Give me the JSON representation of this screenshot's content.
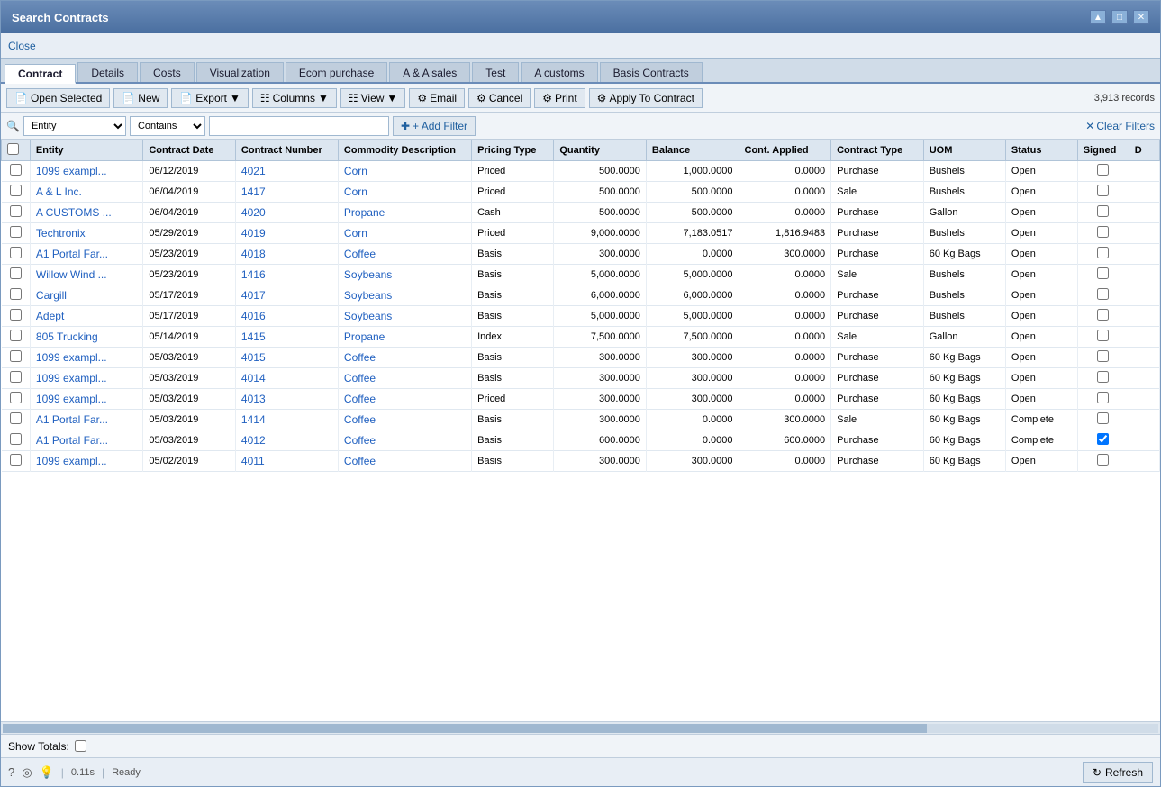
{
  "window": {
    "title": "Search Contracts"
  },
  "menu": {
    "close_label": "Close"
  },
  "tabs": [
    {
      "id": "contract",
      "label": "Contract",
      "active": true
    },
    {
      "id": "details",
      "label": "Details",
      "active": false
    },
    {
      "id": "costs",
      "label": "Costs",
      "active": false
    },
    {
      "id": "visualization",
      "label": "Visualization",
      "active": false
    },
    {
      "id": "ecom",
      "label": "Ecom purchase",
      "active": false
    },
    {
      "id": "aasales",
      "label": "A & A sales",
      "active": false
    },
    {
      "id": "test",
      "label": "Test",
      "active": false
    },
    {
      "id": "acustoms",
      "label": "A customs",
      "active": false
    },
    {
      "id": "basis",
      "label": "Basis Contracts",
      "active": false
    }
  ],
  "toolbar": {
    "open_selected": "Open Selected",
    "new": "New",
    "export": "Export",
    "columns": "Columns",
    "view": "View",
    "email": "Email",
    "cancel": "Cancel",
    "print": "Print",
    "apply_to_contract": "Apply To Contract",
    "record_count": "3,913 records"
  },
  "filter": {
    "field_label": "Entity",
    "operator_label": "Contains",
    "value": "",
    "add_filter_label": "+ Add Filter",
    "clear_filters_label": "Clear Filters"
  },
  "columns": [
    "Entity",
    "Contract Date",
    "Contract Number",
    "Commodity Description",
    "Pricing Type",
    "Quantity",
    "Balance",
    "Cont. Applied",
    "Contract Type",
    "UOM",
    "Status",
    "Signed",
    "D"
  ],
  "rows": [
    {
      "entity": "1099 exampl...",
      "date": "06/12/2019",
      "number": "4021",
      "commodity": "Corn",
      "pricing": "Priced",
      "quantity": "500.0000",
      "balance": "1,000.0000",
      "applied": "0.0000",
      "contract_type": "Purchase",
      "uom": "Bushels",
      "status": "Open",
      "signed": false,
      "checked": false
    },
    {
      "entity": "A & L Inc.",
      "date": "06/04/2019",
      "number": "1417",
      "commodity": "Corn",
      "pricing": "Priced",
      "quantity": "500.0000",
      "balance": "500.0000",
      "applied": "0.0000",
      "contract_type": "Sale",
      "uom": "Bushels",
      "status": "Open",
      "signed": false,
      "checked": false
    },
    {
      "entity": "A CUSTOMS ...",
      "date": "06/04/2019",
      "number": "4020",
      "commodity": "Propane",
      "pricing": "Cash",
      "quantity": "500.0000",
      "balance": "500.0000",
      "applied": "0.0000",
      "contract_type": "Purchase",
      "uom": "Gallon",
      "status": "Open",
      "signed": false,
      "checked": false
    },
    {
      "entity": "Techtronix",
      "date": "05/29/2019",
      "number": "4019",
      "commodity": "Corn",
      "pricing": "Priced",
      "quantity": "9,000.0000",
      "balance": "7,183.0517",
      "applied": "1,816.9483",
      "contract_type": "Purchase",
      "uom": "Bushels",
      "status": "Open",
      "signed": false,
      "checked": false
    },
    {
      "entity": "A1 Portal Far...",
      "date": "05/23/2019",
      "number": "4018",
      "commodity": "Coffee",
      "pricing": "Basis",
      "quantity": "300.0000",
      "balance": "0.0000",
      "applied": "300.0000",
      "contract_type": "Purchase",
      "uom": "60 Kg Bags",
      "status": "Open",
      "signed": false,
      "checked": false
    },
    {
      "entity": "Willow Wind ...",
      "date": "05/23/2019",
      "number": "1416",
      "commodity": "Soybeans",
      "pricing": "Basis",
      "quantity": "5,000.0000",
      "balance": "5,000.0000",
      "applied": "0.0000",
      "contract_type": "Sale",
      "uom": "Bushels",
      "status": "Open",
      "signed": false,
      "checked": false
    },
    {
      "entity": "Cargill",
      "date": "05/17/2019",
      "number": "4017",
      "commodity": "Soybeans",
      "pricing": "Basis",
      "quantity": "6,000.0000",
      "balance": "6,000.0000",
      "applied": "0.0000",
      "contract_type": "Purchase",
      "uom": "Bushels",
      "status": "Open",
      "signed": false,
      "checked": false
    },
    {
      "entity": "Adept",
      "date": "05/17/2019",
      "number": "4016",
      "commodity": "Soybeans",
      "pricing": "Basis",
      "quantity": "5,000.0000",
      "balance": "5,000.0000",
      "applied": "0.0000",
      "contract_type": "Purchase",
      "uom": "Bushels",
      "status": "Open",
      "signed": false,
      "checked": false
    },
    {
      "entity": "805 Trucking",
      "date": "05/14/2019",
      "number": "1415",
      "commodity": "Propane",
      "pricing": "Index",
      "quantity": "7,500.0000",
      "balance": "7,500.0000",
      "applied": "0.0000",
      "contract_type": "Sale",
      "uom": "Gallon",
      "status": "Open",
      "signed": false,
      "checked": false
    },
    {
      "entity": "1099 exampl...",
      "date": "05/03/2019",
      "number": "4015",
      "commodity": "Coffee",
      "pricing": "Basis",
      "quantity": "300.0000",
      "balance": "300.0000",
      "applied": "0.0000",
      "contract_type": "Purchase",
      "uom": "60 Kg Bags",
      "status": "Open",
      "signed": false,
      "checked": false
    },
    {
      "entity": "1099 exampl...",
      "date": "05/03/2019",
      "number": "4014",
      "commodity": "Coffee",
      "pricing": "Basis",
      "quantity": "300.0000",
      "balance": "300.0000",
      "applied": "0.0000",
      "contract_type": "Purchase",
      "uom": "60 Kg Bags",
      "status": "Open",
      "signed": false,
      "checked": false
    },
    {
      "entity": "1099 exampl...",
      "date": "05/03/2019",
      "number": "4013",
      "commodity": "Coffee",
      "pricing": "Priced",
      "quantity": "300.0000",
      "balance": "300.0000",
      "applied": "0.0000",
      "contract_type": "Purchase",
      "uom": "60 Kg Bags",
      "status": "Open",
      "signed": false,
      "checked": false
    },
    {
      "entity": "A1 Portal Far...",
      "date": "05/03/2019",
      "number": "1414",
      "commodity": "Coffee",
      "pricing": "Basis",
      "quantity": "300.0000",
      "balance": "0.0000",
      "applied": "300.0000",
      "contract_type": "Sale",
      "uom": "60 Kg Bags",
      "status": "Complete",
      "signed": false,
      "checked": false
    },
    {
      "entity": "A1 Portal Far...",
      "date": "05/03/2019",
      "number": "4012",
      "commodity": "Coffee",
      "pricing": "Basis",
      "quantity": "600.0000",
      "balance": "0.0000",
      "applied": "600.0000",
      "contract_type": "Purchase",
      "uom": "60 Kg Bags",
      "status": "Complete",
      "signed": true,
      "checked": false
    },
    {
      "entity": "1099 exampl...",
      "date": "05/02/2019",
      "number": "4011",
      "commodity": "Coffee",
      "pricing": "Basis",
      "quantity": "300.0000",
      "balance": "300.0000",
      "applied": "0.0000",
      "contract_type": "Purchase",
      "uom": "60 Kg Bags",
      "status": "Open",
      "signed": false,
      "checked": false
    }
  ],
  "show_totals": {
    "label": "Show Totals:"
  },
  "statusbar": {
    "time": "0.11s",
    "ready": "Ready",
    "refresh": "Refresh"
  }
}
